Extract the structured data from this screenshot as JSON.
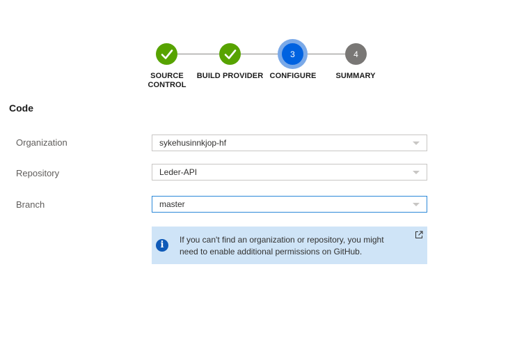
{
  "stepper": {
    "steps": [
      {
        "label_line1": "SOURCE",
        "label_line2": "CONTROL",
        "state": "done",
        "icon": "checkmark-icon"
      },
      {
        "label_line1": "BUILD PROVIDER",
        "label_line2": "",
        "state": "done",
        "icon": "checkmark-icon"
      },
      {
        "label_line1": "CONFIGURE",
        "label_line2": "",
        "state": "active",
        "number": "3"
      },
      {
        "label_line1": "SUMMARY",
        "label_line2": "",
        "state": "pending",
        "number": "4"
      }
    ]
  },
  "section": {
    "title": "Code"
  },
  "fields": {
    "organization": {
      "label": "Organization",
      "value": "sykehusinnkjop-hf"
    },
    "repository": {
      "label": "Repository",
      "value": "Leder-API"
    },
    "branch": {
      "label": "Branch",
      "value": "master"
    }
  },
  "info": {
    "icon": "info-icon",
    "line1": "If you can't find an organization or repository, you might",
    "line2": "need to enable additional permissions on GitHub.",
    "link_icon": "external-link-icon"
  },
  "colors": {
    "step_done": "#57a300",
    "step_active": "#0062e0",
    "step_active_ring": "#7aa9e8",
    "step_pending": "#797775",
    "info_background": "#cfe4f7",
    "info_icon": "#0f5ab8",
    "focus_border": "#2b88d8"
  }
}
